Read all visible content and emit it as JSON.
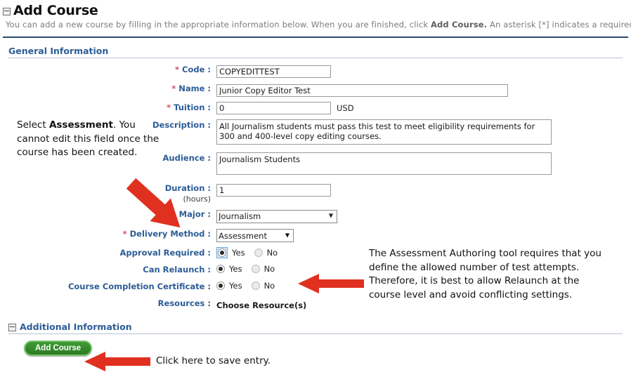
{
  "header": {
    "title": "Add Course",
    "toggle_icon": "collapse-box-icon",
    "subtitle_before": "You can add a new course by filling in the appropriate information below. When you are finished, click ",
    "subtitle_bold": "Add Course.",
    "subtitle_after": " An asterisk [*] indicates a required field."
  },
  "sections": {
    "general": {
      "title": "General Information",
      "toggle_icon": "collapse-box-icon"
    },
    "additional": {
      "title": "Additional Information",
      "toggle_icon": "collapse-box-icon"
    }
  },
  "form": {
    "code": {
      "label": "Code :",
      "required": "*",
      "value": "COPYEDITTEST"
    },
    "name": {
      "label": "Name :",
      "required": "*",
      "value": "Junior Copy Editor Test"
    },
    "tuition": {
      "label": "Tuition :",
      "required": "*",
      "value": "0",
      "currency": "USD"
    },
    "description": {
      "label": "Description :",
      "value": "All Journalism students must pass this test to meet eligibility requirements for 300 and 400-level copy editing courses."
    },
    "audience": {
      "label": "Audience :",
      "value": "Journalism Students"
    },
    "duration": {
      "label": "Duration :",
      "sub_label": "(hours)",
      "value": "1"
    },
    "major": {
      "label": "Major :",
      "value": "Journalism",
      "options": [
        "Journalism"
      ]
    },
    "delivery": {
      "label": "Delivery Method :",
      "required": "*",
      "value": "Assessment",
      "options": [
        "Assessment"
      ],
      "highlight_color": "#ffff00"
    },
    "approval": {
      "label": "Approval Required :",
      "yes": "Yes",
      "no": "No",
      "selected": "Yes"
    },
    "relaunch": {
      "label": "Can Relaunch :",
      "yes": "Yes",
      "no": "No",
      "selected": "Yes"
    },
    "certificate": {
      "label": "Course Completion Certificate :",
      "yes": "Yes",
      "no": "No",
      "selected": "Yes"
    },
    "resources": {
      "label": "Resources :",
      "value": "Choose Resource(s)"
    }
  },
  "footer": {
    "add_button": "Add Course"
  },
  "annotations": {
    "left": {
      "line1_pre": "Select ",
      "line1_bold": "Assessment",
      "line1_post": ".",
      "rest": "You cannot edit this field once the course has been created."
    },
    "right": "The Assessment Authoring tool requires that you define the allowed number of test attempts. Therefore, it is best to allow Relaunch at the course level and avoid conflicting settings.",
    "save": "Click here to save entry."
  },
  "colors": {
    "label_blue": "#2c5d96",
    "required_red": "#d05070",
    "rule_blue": "#2b4a72",
    "arrow_red": "#e03020",
    "button_green": "#2d7a24",
    "highlight_yellow": "#ffff00"
  }
}
